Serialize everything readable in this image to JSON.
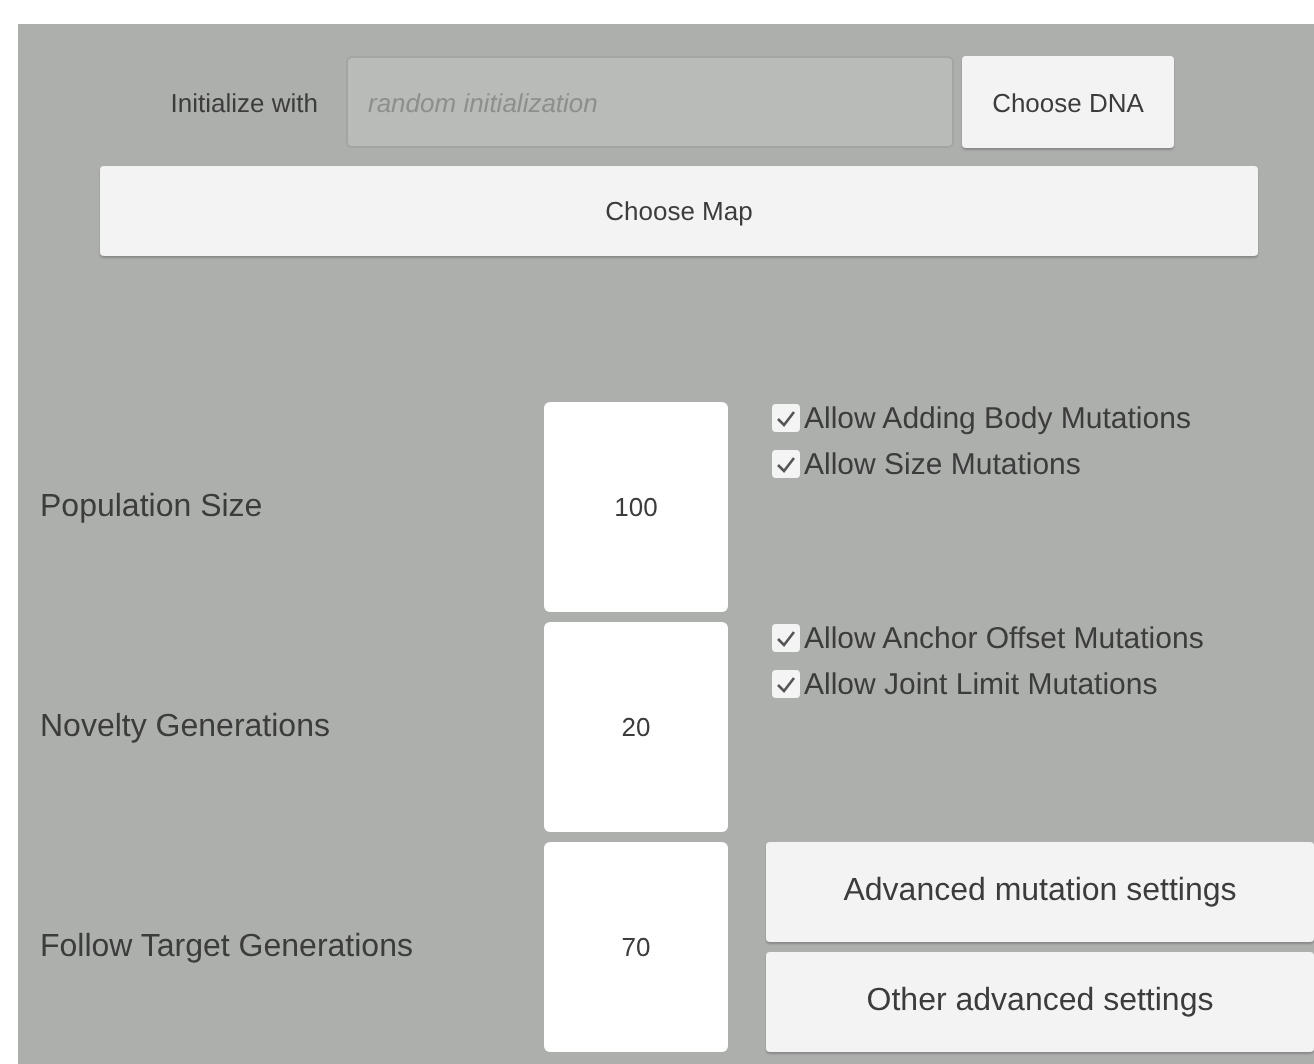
{
  "initialize": {
    "label": "Initialize with",
    "placeholder": "random initialization",
    "button": "Choose DNA"
  },
  "map_button": "Choose Map",
  "rows": [
    {
      "label": "Population Size",
      "value": "100",
      "side": {
        "kind": "checkboxes",
        "items": [
          {
            "label": "Allow Adding Body Mutations",
            "checked": true
          },
          {
            "label": "Allow Size Mutations",
            "checked": true
          }
        ]
      }
    },
    {
      "label": "Novelty Generations",
      "value": "20",
      "side": {
        "kind": "checkboxes",
        "items": [
          {
            "label": "Allow Anchor Offset Mutations",
            "checked": true
          },
          {
            "label": "Allow Joint Limit Mutations",
            "checked": true
          }
        ]
      }
    },
    {
      "label": "Follow Target Generations",
      "value": "70",
      "side": {
        "kind": "buttons",
        "items": [
          {
            "label": "Advanced mutation settings"
          },
          {
            "label": "Other advanced settings"
          }
        ]
      }
    }
  ]
}
